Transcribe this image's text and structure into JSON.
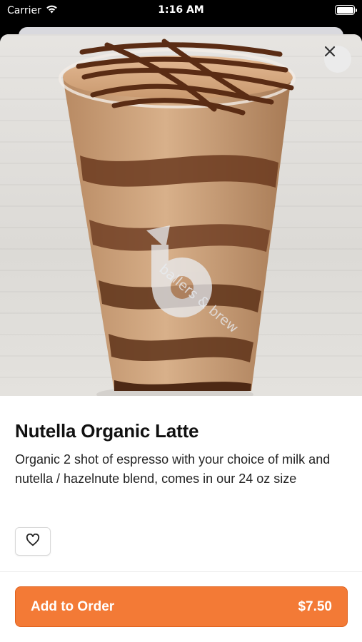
{
  "status_bar": {
    "carrier": "Carrier",
    "time": "1:16 AM"
  },
  "product": {
    "title": "Nutella Organic Latte",
    "description": "Organic 2 shot of espresso with your choice of milk and nutella / hazelnute blend, comes in our 24 oz size",
    "cup_logo_text": "ballers & brew"
  },
  "actions": {
    "add_to_order_label": "Add to Order",
    "price": "$7.50"
  },
  "icons": {
    "close": "close-icon",
    "favorite": "heart-outline-icon",
    "wifi": "wifi-icon",
    "battery": "battery-icon"
  },
  "colors": {
    "accent": "#f37a36"
  }
}
